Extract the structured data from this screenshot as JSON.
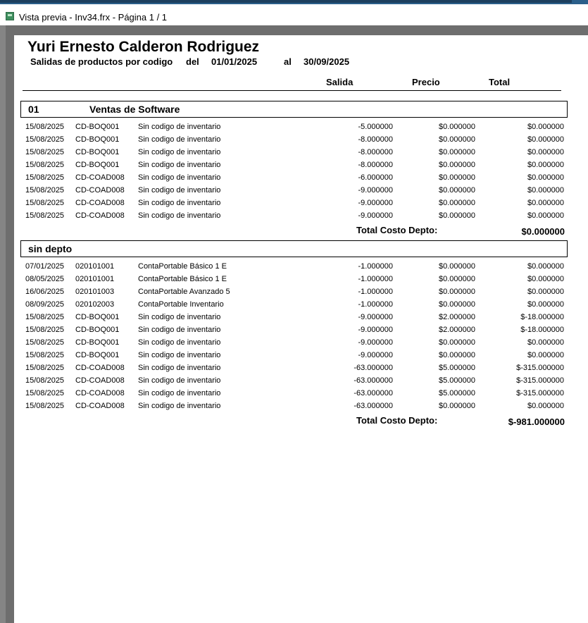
{
  "window": {
    "title": "Vista previa - Inv34.frx - Página 1 / 1"
  },
  "report": {
    "company": "Yuri Ernesto Calderon Rodriguez",
    "subtitle": "Salidas de productos por codigo",
    "del_label": "del",
    "date_from": "01/01/2025",
    "al_label": "al",
    "date_to": "30/09/2025",
    "columns": {
      "salida": "Salida",
      "precio": "Precio",
      "total": "Total"
    },
    "total_label": "Total Costo Depto:"
  },
  "groups": [
    {
      "code": "01",
      "name": "Ventas de Software",
      "rows": [
        {
          "date": "15/08/2025",
          "code": "CD-BOQ001",
          "desc": "Sin codigo de inventario",
          "qty": "-5.000000",
          "price": "$0.000000",
          "total": "$0.000000"
        },
        {
          "date": "15/08/2025",
          "code": "CD-BOQ001",
          "desc": "Sin codigo de inventario",
          "qty": "-8.000000",
          "price": "$0.000000",
          "total": "$0.000000"
        },
        {
          "date": "15/08/2025",
          "code": "CD-BOQ001",
          "desc": "Sin codigo de inventario",
          "qty": "-8.000000",
          "price": "$0.000000",
          "total": "$0.000000"
        },
        {
          "date": "15/08/2025",
          "code": "CD-BOQ001",
          "desc": "Sin codigo de inventario",
          "qty": "-8.000000",
          "price": "$0.000000",
          "total": "$0.000000"
        },
        {
          "date": "15/08/2025",
          "code": "CD-COAD008",
          "desc": "Sin codigo de inventario",
          "qty": "-6.000000",
          "price": "$0.000000",
          "total": "$0.000000"
        },
        {
          "date": "15/08/2025",
          "code": "CD-COAD008",
          "desc": "Sin codigo de inventario",
          "qty": "-9.000000",
          "price": "$0.000000",
          "total": "$0.000000"
        },
        {
          "date": "15/08/2025",
          "code": "CD-COAD008",
          "desc": "Sin codigo de inventario",
          "qty": "-9.000000",
          "price": "$0.000000",
          "total": "$0.000000"
        },
        {
          "date": "15/08/2025",
          "code": "CD-COAD008",
          "desc": "Sin codigo de inventario",
          "qty": "-9.000000",
          "price": "$0.000000",
          "total": "$0.000000"
        }
      ],
      "total": "$0.000000"
    },
    {
      "code": "",
      "name": "sin depto",
      "rows": [
        {
          "date": "07/01/2025",
          "code": "020101001",
          "desc": "ContaPortable Básico 1 E",
          "qty": "-1.000000",
          "price": "$0.000000",
          "total": "$0.000000"
        },
        {
          "date": "08/05/2025",
          "code": "020101001",
          "desc": "ContaPortable Básico 1 E",
          "qty": "-1.000000",
          "price": "$0.000000",
          "total": "$0.000000"
        },
        {
          "date": "16/06/2025",
          "code": "020101003",
          "desc": "ContaPortable Avanzado 5",
          "qty": "-1.000000",
          "price": "$0.000000",
          "total": "$0.000000"
        },
        {
          "date": "08/09/2025",
          "code": "020102003",
          "desc": "ContaPortable Inventario",
          "qty": "-1.000000",
          "price": "$0.000000",
          "total": "$0.000000"
        },
        {
          "date": "15/08/2025",
          "code": "CD-BOQ001",
          "desc": "Sin codigo de inventario",
          "qty": "-9.000000",
          "price": "$2.000000",
          "total": "$-18.000000"
        },
        {
          "date": "15/08/2025",
          "code": "CD-BOQ001",
          "desc": "Sin codigo de inventario",
          "qty": "-9.000000",
          "price": "$2.000000",
          "total": "$-18.000000"
        },
        {
          "date": "15/08/2025",
          "code": "CD-BOQ001",
          "desc": "Sin codigo de inventario",
          "qty": "-9.000000",
          "price": "$0.000000",
          "total": "$0.000000"
        },
        {
          "date": "15/08/2025",
          "code": "CD-BOQ001",
          "desc": "Sin codigo de inventario",
          "qty": "-9.000000",
          "price": "$0.000000",
          "total": "$0.000000"
        },
        {
          "date": "15/08/2025",
          "code": "CD-COAD008",
          "desc": "Sin codigo de inventario",
          "qty": "-63.000000",
          "price": "$5.000000",
          "total": "$-315.000000"
        },
        {
          "date": "15/08/2025",
          "code": "CD-COAD008",
          "desc": "Sin codigo de inventario",
          "qty": "-63.000000",
          "price": "$5.000000",
          "total": "$-315.000000"
        },
        {
          "date": "15/08/2025",
          "code": "CD-COAD008",
          "desc": "Sin codigo de inventario",
          "qty": "-63.000000",
          "price": "$5.000000",
          "total": "$-315.000000"
        },
        {
          "date": "15/08/2025",
          "code": "CD-COAD008",
          "desc": "Sin codigo de inventario",
          "qty": "-63.000000",
          "price": "$0.000000",
          "total": "$0.000000"
        }
      ],
      "total": "$-981.000000"
    }
  ]
}
